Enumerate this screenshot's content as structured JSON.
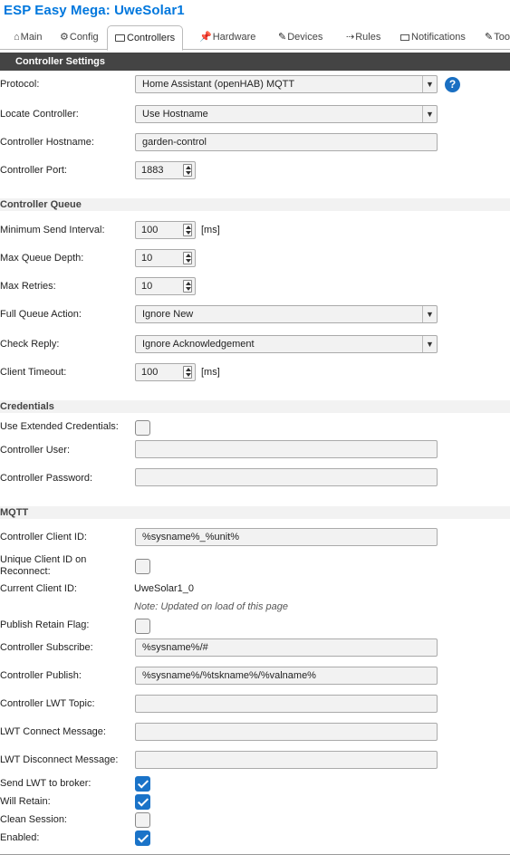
{
  "app": {
    "title": "ESP Easy Mega: UweSolar1"
  },
  "tabs": [
    {
      "icon": "⌂",
      "label": "Main"
    },
    {
      "icon": "⚙",
      "label": "Config"
    },
    {
      "icon": "",
      "label": "Controllers"
    },
    {
      "icon": "📌",
      "label": "Hardware"
    },
    {
      "icon": "✎",
      "label": "Devices"
    },
    {
      "icon": "⇢",
      "label": "Rules"
    },
    {
      "icon": "",
      "label": "Notifications"
    },
    {
      "icon": "✎",
      "label": "Too"
    }
  ],
  "header": "Controller Settings",
  "settings": {
    "protocol_label": "Protocol:",
    "protocol_value": "Home Assistant (openHAB) MQTT",
    "help_label": "?",
    "locate_label": "Locate Controller:",
    "locate_value": "Use Hostname",
    "hostname_label": "Controller Hostname:",
    "hostname_value": "garden-control",
    "port_label": "Controller Port:",
    "port_value": "1883"
  },
  "queue": {
    "title": "Controller Queue",
    "min_interval_label": "Minimum Send Interval:",
    "min_interval_value": "100",
    "min_interval_unit": "[ms]",
    "max_depth_label": "Max Queue Depth:",
    "max_depth_value": "10",
    "max_retries_label": "Max Retries:",
    "max_retries_value": "10",
    "full_action_label": "Full Queue Action:",
    "full_action_value": "Ignore New",
    "check_reply_label": "Check Reply:",
    "check_reply_value": "Ignore Acknowledgement",
    "timeout_label": "Client Timeout:",
    "timeout_value": "100",
    "timeout_unit": "[ms]"
  },
  "credentials": {
    "title": "Credentials",
    "extended_label": "Use Extended Credentials:",
    "extended_checked": false,
    "user_label": "Controller User:",
    "user_value": "",
    "password_label": "Controller Password:",
    "password_value": ""
  },
  "mqtt": {
    "title": "MQTT",
    "client_id_label": "Controller Client ID:",
    "client_id_value": "%sysname%_%unit%",
    "unique_label": "Unique Client ID on Reconnect:",
    "unique_checked": false,
    "current_id_label": "Current Client ID:",
    "current_id_value": "UweSolar1_0",
    "current_id_note": "Note: Updated on load of this page",
    "retain_label": "Publish Retain Flag:",
    "retain_checked": false,
    "subscribe_label": "Controller Subscribe:",
    "subscribe_value": "%sysname%/#",
    "publish_label": "Controller Publish:",
    "publish_value": "%sysname%/%tskname%/%valname%",
    "lwt_topic_label": "Controller LWT Topic:",
    "lwt_topic_value": "",
    "lwt_connect_label": "LWT Connect Message:",
    "lwt_connect_value": "",
    "lwt_disconnect_label": "LWT Disconnect Message:",
    "lwt_disconnect_value": "",
    "send_lwt_label": "Send LWT to broker:",
    "send_lwt_checked": true,
    "will_retain_label": "Will Retain:",
    "will_retain_checked": true,
    "clean_session_label": "Clean Session:",
    "clean_session_checked": false,
    "enabled_label": "Enabled:",
    "enabled_checked": true
  },
  "colors": {
    "title": "#0077dd",
    "band": "#444444",
    "checkbox_on": "#1a73c8"
  }
}
